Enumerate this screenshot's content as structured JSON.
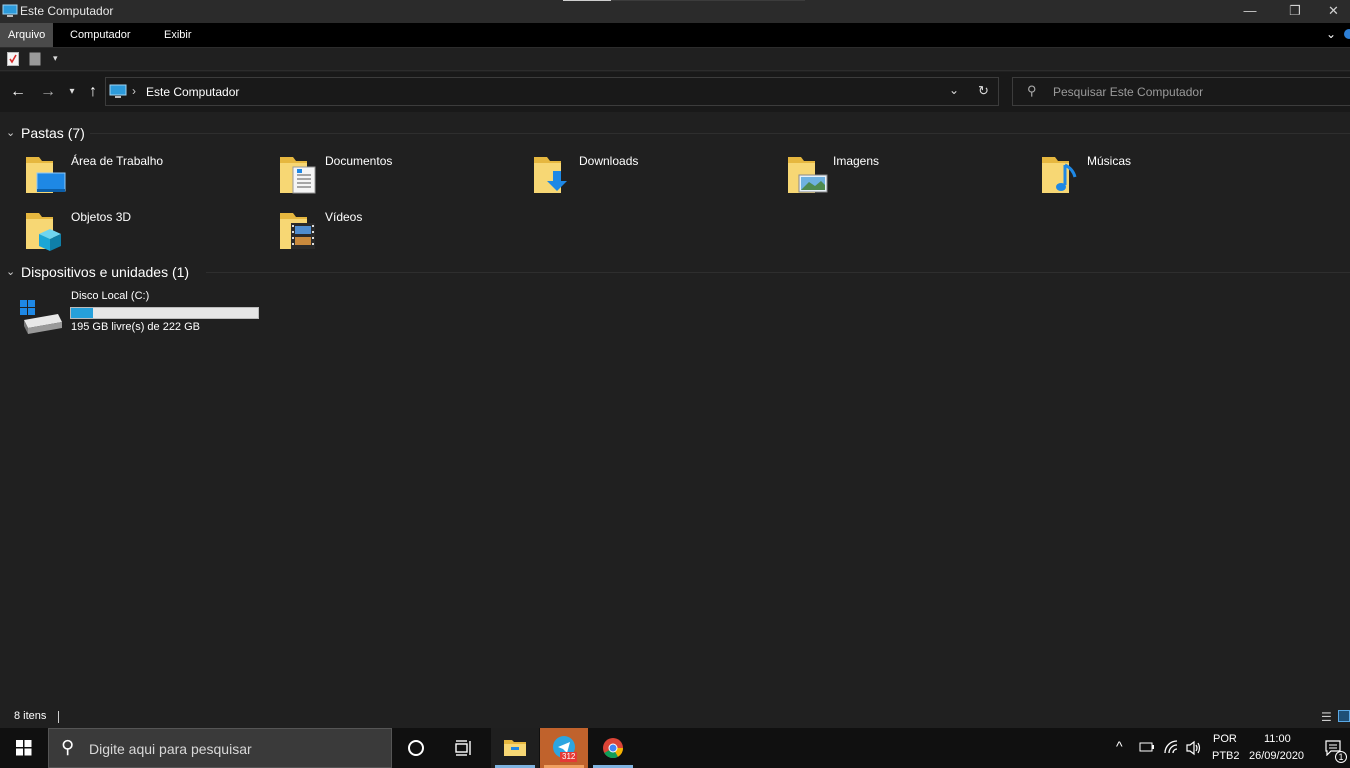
{
  "window": {
    "title": "Este Computador"
  },
  "ribbon": {
    "tabs": [
      "Arquivo",
      "Computador",
      "Exibir"
    ]
  },
  "nav": {
    "breadcrumb": "Este Computador",
    "search_placeholder": "Pesquisar Este Computador"
  },
  "sections": {
    "folders_title": "Pastas (7)",
    "devices_title": "Dispositivos e unidades (1)"
  },
  "folders": [
    {
      "label": "Área de Trabalho",
      "icon": "desktop-folder-icon"
    },
    {
      "label": "Documentos",
      "icon": "documents-folder-icon"
    },
    {
      "label": "Downloads",
      "icon": "downloads-folder-icon"
    },
    {
      "label": "Imagens",
      "icon": "pictures-folder-icon"
    },
    {
      "label": "Músicas",
      "icon": "music-folder-icon"
    },
    {
      "label": "Objetos 3D",
      "icon": "3d-objects-folder-icon"
    },
    {
      "label": "Vídeos",
      "icon": "videos-folder-icon"
    }
  ],
  "drive": {
    "label": "Disco Local (C:)",
    "free_text": "195 GB livre(s) de 222 GB",
    "used_fraction": 0.12
  },
  "status": {
    "count": "8 itens"
  },
  "taskbar": {
    "search_placeholder": "Digite aqui para pesquisar",
    "telegram_badge": "312",
    "lang_top": "POR",
    "lang_bottom": "PTB2",
    "time": "11:00",
    "date": "26/09/2020",
    "notification_count": "1"
  },
  "colors": {
    "background": "#202020",
    "folder_yellow": "#f2c94c",
    "accent_blue": "#2d9bdb",
    "taskbar": "#101010"
  }
}
